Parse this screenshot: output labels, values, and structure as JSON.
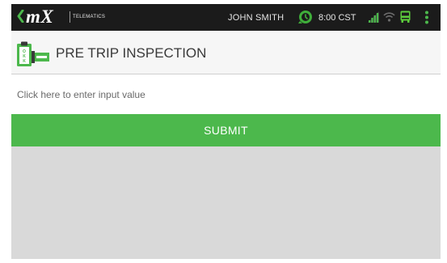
{
  "status_bar": {
    "logo_text": "mX",
    "logo_subtitle": "TELEMATICS",
    "user_name": "JOHN SMITH",
    "time": "8:00 CST",
    "icons": [
      "logo-chevron-icon",
      "clock-icon",
      "signal-icon",
      "wifi-icon",
      "bus-icon",
      "overflow-menu-icon"
    ],
    "colors": {
      "background": "#1b1b1b",
      "accent_green": "#4cb84c",
      "clock_green": "#3fae3a",
      "bus_green": "#5ccc3c",
      "wifi_grey": "#6c6c6c"
    }
  },
  "header": {
    "title": "PRE TRIP INSPECTION",
    "icon": "inspection-clipboard-icon",
    "icon_letters": "OKK"
  },
  "form": {
    "input_value": "",
    "input_placeholder": "Click here to enter input value",
    "submit_label": "SUBMIT",
    "submit_color": "#4cb84c"
  }
}
